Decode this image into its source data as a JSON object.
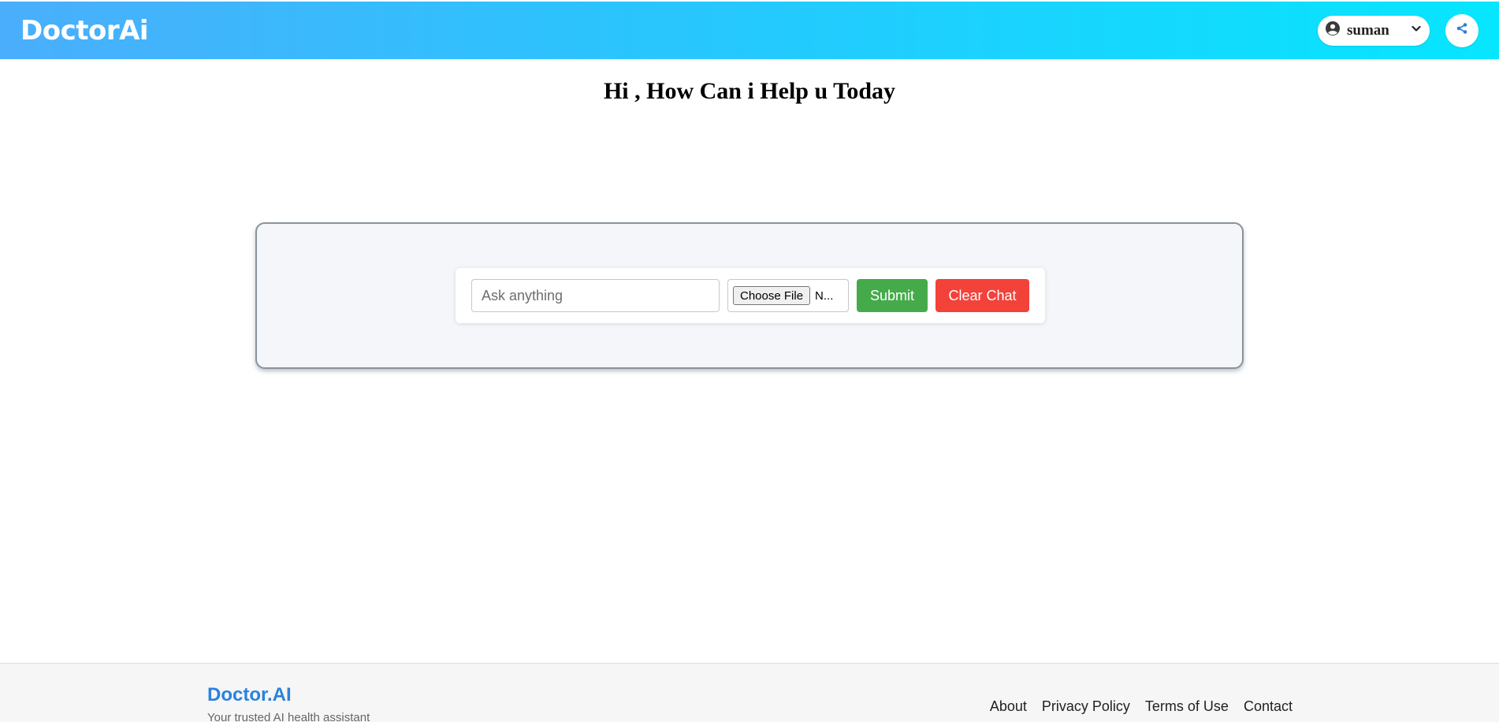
{
  "header": {
    "logo": "DoctorAi",
    "user": {
      "name": "suman",
      "icon": "user-circle-icon",
      "dropdown_icon": "chevron-down-icon"
    },
    "share_icon": "share-icon"
  },
  "main": {
    "title": "Hi , How Can i Help u Today"
  },
  "chat": {
    "input_placeholder": "Ask anything",
    "input_value": "",
    "file_button_label": "Choose File",
    "file_status": "N...",
    "submit_label": "Submit",
    "clear_label": "Clear Chat"
  },
  "footer": {
    "brand": "Doctor.AI",
    "tagline": "Your trusted AI health assistant",
    "links": [
      {
        "label": "About"
      },
      {
        "label": "Privacy Policy"
      },
      {
        "label": "Terms of Use"
      },
      {
        "label": "Contact"
      }
    ]
  },
  "colors": {
    "header_gradient_start": "#4aaefc",
    "header_gradient_end": "#06e6ff",
    "submit": "#45ab4a",
    "clear": "#f2423a",
    "footer_brand": "#2b82dc"
  }
}
